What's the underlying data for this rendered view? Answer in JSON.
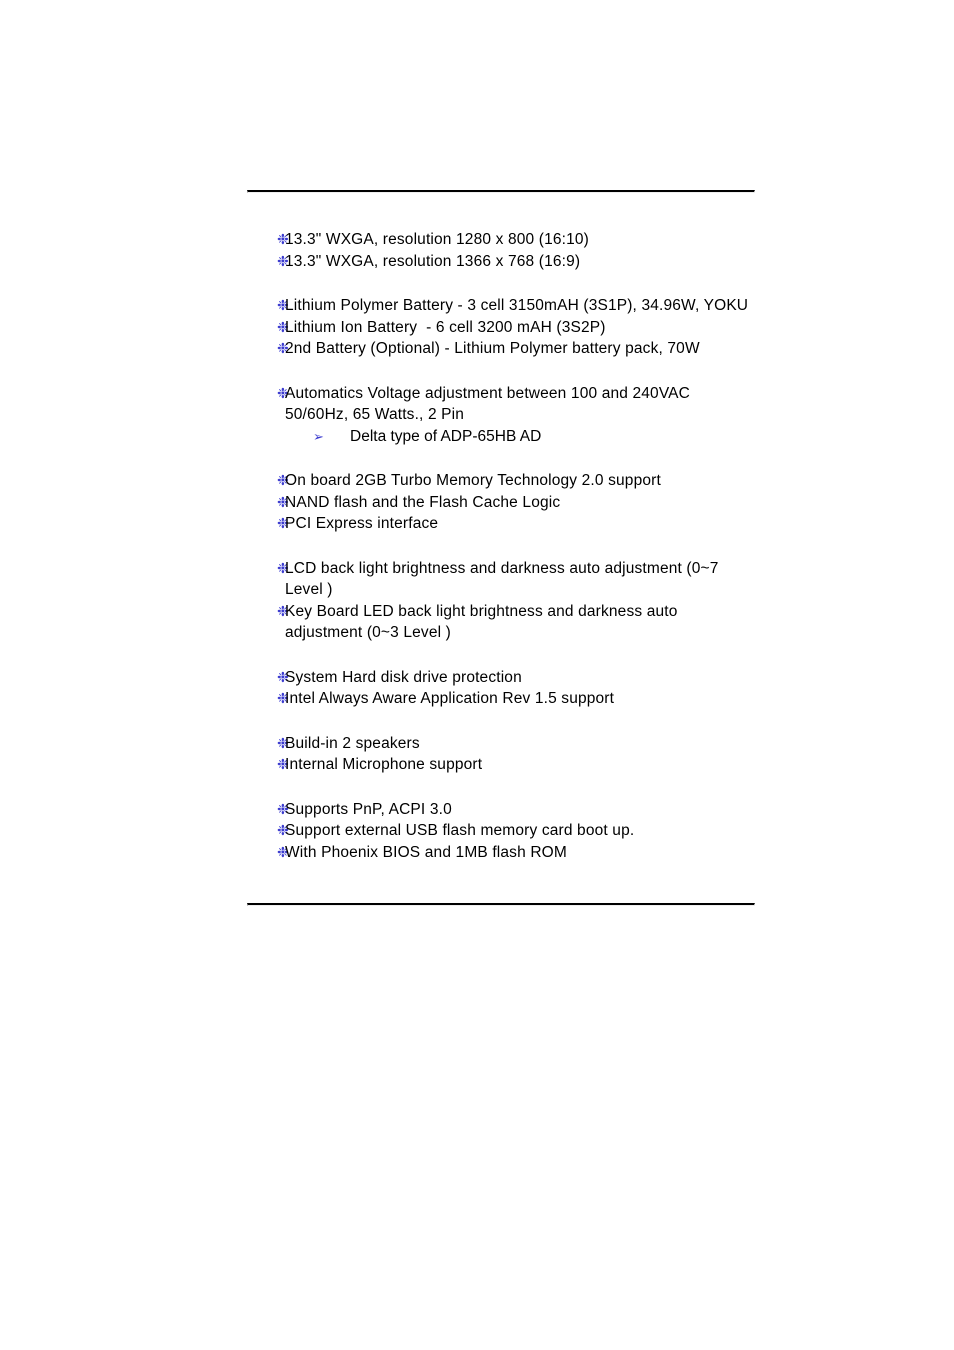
{
  "page": {
    "background_color": "#ffffff",
    "text_color": "#000000",
    "bullet_color": "#3b3bcf",
    "rule_color": "#000000"
  },
  "markers": {
    "bullet_glyph": "❉",
    "bullet_icon_name": "snowflake-bullet-icon",
    "sub_bullet_glyph": "➢",
    "sub_bullet_icon_name": "arrow-bullet-icon"
  },
  "groups": [
    {
      "id": "lcd-panel",
      "items": [
        {
          "text": "13.3\" WXGA, resolution 1280 x 800 (16:10)",
          "subitems": []
        },
        {
          "text": "13.3\" WXGA, resolution 1366 x 768 (16:9)",
          "subitems": []
        }
      ]
    },
    {
      "id": "battery",
      "items": [
        {
          "text": "Lithium Polymer Battery - 3 cell 3150mAH (3S1P), 34.96W, YOKU",
          "subitems": []
        },
        {
          "text": "Lithium Ion Battery  - 6 cell 3200 mAH (3S2P)",
          "subitems": []
        },
        {
          "text": "2nd Battery (Optional) - Lithium Polymer battery pack, 70W",
          "subitems": []
        }
      ]
    },
    {
      "id": "ac-adapter",
      "items": [
        {
          "text": "Automatics Voltage adjustment between 100 and 240VAC 50/60Hz, 65 Watts., 2 Pin",
          "subitems": [
            "Delta type of ADP-65HB AD"
          ]
        }
      ]
    },
    {
      "id": "turbo-memory",
      "items": [
        {
          "text": "On board 2GB Turbo Memory Technology 2.0 support",
          "subitems": []
        },
        {
          "text": "NAND flash and the Flash Cache Logic",
          "subitems": []
        },
        {
          "text": "PCI Express interface",
          "subitems": []
        }
      ]
    },
    {
      "id": "light-sensor",
      "items": [
        {
          "text": "LCD back light brightness and darkness auto adjustment (0~7 Level )",
          "subitems": []
        },
        {
          "text": "Key Board LED back light brightness and darkness auto adjustment (0~3 Level )",
          "subitems": []
        }
      ]
    },
    {
      "id": "g-sensor",
      "items": [
        {
          "text": "System Hard disk drive protection",
          "subitems": []
        },
        {
          "text": "Intel Always Aware Application Rev 1.5 support",
          "subitems": []
        }
      ]
    },
    {
      "id": "audio",
      "items": [
        {
          "text": "Build-in 2 speakers",
          "subitems": []
        },
        {
          "text": "Internal Microphone support",
          "subitems": []
        }
      ]
    },
    {
      "id": "bios",
      "items": [
        {
          "text": "Supports PnP, ACPI 3.0",
          "subitems": []
        },
        {
          "text": "Support external USB flash memory card boot up.",
          "subitems": []
        },
        {
          "text": "With Phoenix BIOS and 1MB flash ROM",
          "subitems": []
        }
      ]
    }
  ]
}
